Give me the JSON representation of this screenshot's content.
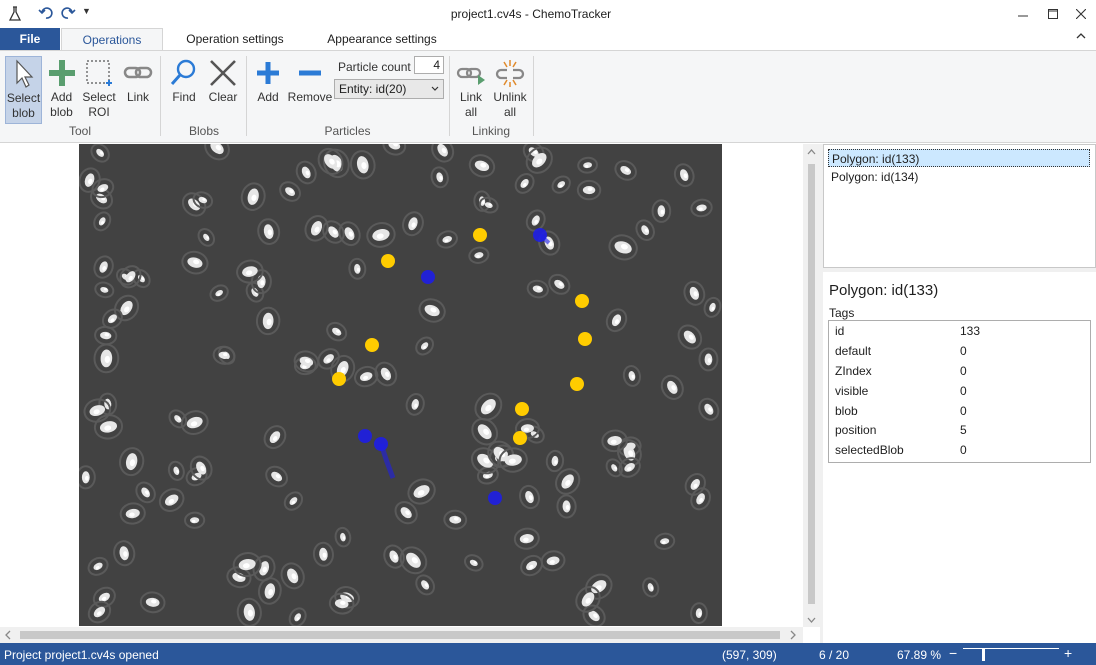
{
  "window": {
    "title": "project1.cv4s - ChemoTracker",
    "icons": {
      "app": "flask-icon",
      "undo": "undo-icon",
      "redo": "redo-icon",
      "quick_access": "chevron-down-icon",
      "minimize": "minimize-icon",
      "maximize": "maximize-icon",
      "close": "close-icon"
    }
  },
  "tabs": [
    {
      "label": "File"
    },
    {
      "label": "Operations",
      "active": true
    },
    {
      "label": "Operation settings"
    },
    {
      "label": "Appearance settings"
    }
  ],
  "ribbon": {
    "groups": {
      "tool": {
        "label": "Tool",
        "buttons": [
          {
            "label1": "Select",
            "label2": "blob",
            "icon": "cursor-icon",
            "active": true
          },
          {
            "label1": "Add",
            "label2": "blob",
            "icon": "plus-icon"
          },
          {
            "label1": "Select",
            "label2": "ROI",
            "icon": "roi-icon"
          },
          {
            "label1": "Link",
            "label2": "",
            "icon": "link-icon"
          }
        ]
      },
      "blobs": {
        "label": "Blobs",
        "buttons": [
          {
            "label1": "Find",
            "icon": "search-icon"
          },
          {
            "label1": "Clear",
            "icon": "clear-icon"
          }
        ]
      },
      "particles": {
        "label": "Particles",
        "buttons": [
          {
            "label1": "Add",
            "icon": "plus-icon"
          },
          {
            "label1": "Remove",
            "icon": "minus-icon"
          }
        ],
        "particle_count_label": "Particle count",
        "particle_count_value": "4",
        "entity_selected": "Entity: id(20)"
      },
      "linking": {
        "label": "Linking",
        "buttons": [
          {
            "label1": "Link",
            "label2": "all",
            "icon": "link-all-icon"
          },
          {
            "label1": "Unlink",
            "label2": "all",
            "icon": "unlink-all-icon"
          }
        ]
      }
    }
  },
  "entity_list": [
    {
      "label": "Polygon: id(133)",
      "selected": true
    },
    {
      "label": "Polygon: id(134)"
    }
  ],
  "details": {
    "title": "Polygon: id(133)",
    "tags_label": "Tags",
    "tags": [
      {
        "key": "id",
        "value": "133"
      },
      {
        "key": "default",
        "value": "0"
      },
      {
        "key": "ZIndex",
        "value": "0"
      },
      {
        "key": "visible",
        "value": "0"
      },
      {
        "key": "blob",
        "value": "0"
      },
      {
        "key": "position",
        "value": "5"
      },
      {
        "key": "selectedBlob",
        "value": "0"
      }
    ]
  },
  "status": {
    "message": "Project project1.cv4s opened",
    "coords": "(597, 309)",
    "frame": "6 / 20",
    "zoom": "67.89 %",
    "zoom_minus": "−",
    "zoom_plus": "+"
  },
  "colors": {
    "accent": "#2b579a",
    "particle_yellow": "#ffcc00",
    "particle_blue": "#1e1ee6",
    "image_bg": "#424242"
  }
}
